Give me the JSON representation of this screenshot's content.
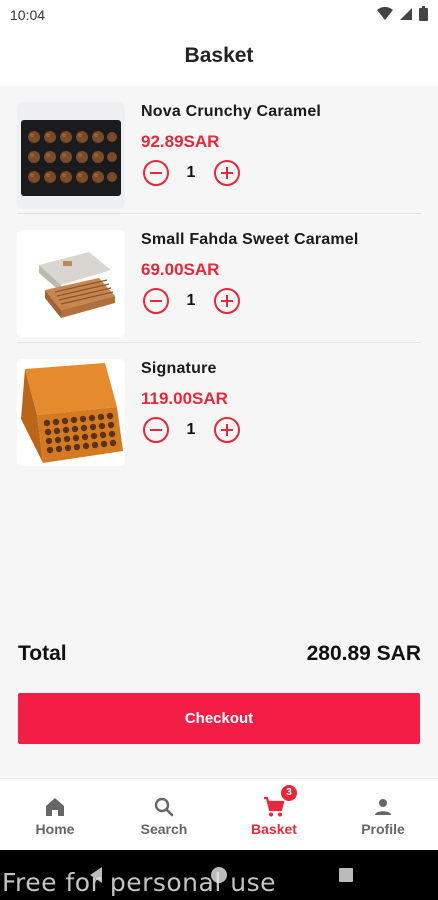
{
  "status_bar": {
    "time": "10:04"
  },
  "header": {
    "title": "Basket"
  },
  "basket": {
    "items": [
      {
        "name": "Nova Crunchy Caramel",
        "price": "92.89SAR",
        "quantity": "1"
      },
      {
        "name": "Small Fahda Sweet Caramel",
        "price": "69.00SAR",
        "quantity": "1"
      },
      {
        "name": "Signature",
        "price": "119.00SAR",
        "quantity": "1"
      }
    ]
  },
  "summary": {
    "total_label": "Total",
    "total_value": "280.89 SAR"
  },
  "checkout": {
    "label": "Checkout"
  },
  "bottom_nav": {
    "items": [
      {
        "label": "Home",
        "icon": "home-icon"
      },
      {
        "label": "Search",
        "icon": "search-icon"
      },
      {
        "label": "Basket",
        "icon": "cart-icon",
        "badge": "3"
      },
      {
        "label": "Profile",
        "icon": "person-icon"
      }
    ],
    "active": "Basket"
  },
  "watermark": "Free for personal use",
  "colors": {
    "accent": "#e8273a",
    "button": "#f31e45"
  }
}
